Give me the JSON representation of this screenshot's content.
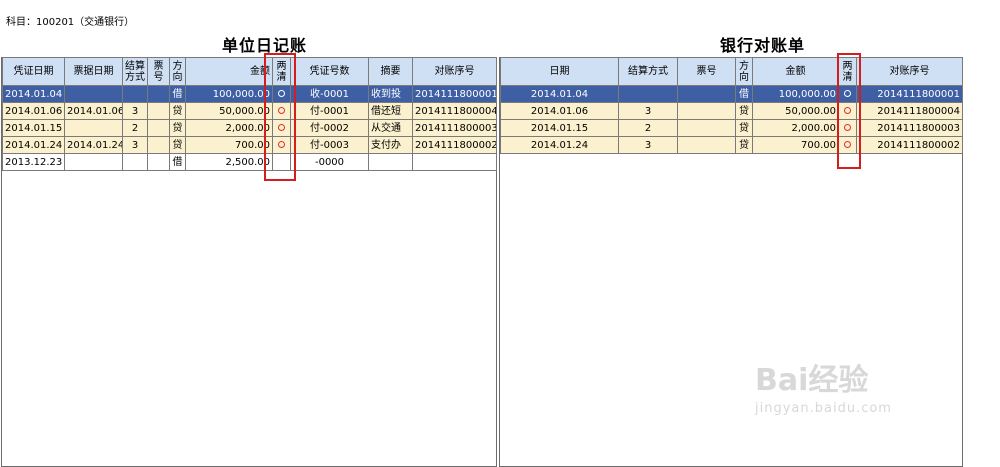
{
  "subject": "科目：100201（交通银行）",
  "journal": {
    "title": "单位日记账",
    "columns": [
      "凭证日期",
      "票据日期",
      "结算方式",
      "票号",
      "方向",
      "金额",
      "两清",
      "凭证号数",
      "摘要",
      "对账序号"
    ],
    "rows": [
      {
        "voucher_date": "2014.01.04",
        "bill_date": "",
        "method": "",
        "ticket": "",
        "direction": "借",
        "amount": "100,000.00",
        "cleared": true,
        "voucher_no": "收-0001",
        "summary": "收到投",
        "seq": "2014111800001",
        "state": "selected"
      },
      {
        "voucher_date": "2014.01.06",
        "bill_date": "2014.01.06",
        "method": "3",
        "ticket": "",
        "direction": "贷",
        "amount": "50,000.00",
        "cleared": true,
        "voucher_no": "付-0001",
        "summary": "借还短",
        "seq": "2014111800004",
        "state": "data"
      },
      {
        "voucher_date": "2014.01.15",
        "bill_date": "",
        "method": "2",
        "ticket": "",
        "direction": "贷",
        "amount": "2,000.00",
        "cleared": true,
        "voucher_no": "付-0002",
        "summary": "从交通",
        "seq": "2014111800003",
        "state": "data"
      },
      {
        "voucher_date": "2014.01.24",
        "bill_date": "2014.01.24",
        "method": "3",
        "ticket": "",
        "direction": "贷",
        "amount": "700.00",
        "cleared": true,
        "voucher_no": "付-0003",
        "summary": "支付办",
        "seq": "2014111800002",
        "state": "data"
      },
      {
        "voucher_date": "2013.12.23",
        "bill_date": "",
        "method": "",
        "ticket": "",
        "direction": "借",
        "amount": "2,500.00",
        "cleared": false,
        "voucher_no": "-0000",
        "summary": "",
        "seq": "",
        "state": "plain"
      }
    ]
  },
  "statement": {
    "title": "银行对账单",
    "columns": [
      "日期",
      "结算方式",
      "票号",
      "方向",
      "金额",
      "两清",
      "对账序号"
    ],
    "rows": [
      {
        "date": "2014.01.04",
        "method": "",
        "ticket": "",
        "direction": "借",
        "amount": "100,000.00",
        "cleared": true,
        "seq": "2014111800001",
        "state": "selected"
      },
      {
        "date": "2014.01.06",
        "method": "3",
        "ticket": "",
        "direction": "贷",
        "amount": "50,000.00",
        "cleared": true,
        "seq": "2014111800004",
        "state": "data"
      },
      {
        "date": "2014.01.15",
        "method": "2",
        "ticket": "",
        "direction": "贷",
        "amount": "2,000.00",
        "cleared": true,
        "seq": "2014111800003",
        "state": "data"
      },
      {
        "date": "2014.01.24",
        "method": "3",
        "ticket": "",
        "direction": "贷",
        "amount": "700.00",
        "cleared": true,
        "seq": "2014111800002",
        "state": "data"
      }
    ]
  },
  "colors": {
    "header": "#cfe0f4",
    "selected": "#3e5fa3",
    "row": "#fbf1cf",
    "mark": "#e0302a",
    "highlight": "#d41e1e"
  },
  "icons": {
    "cleared": "circle-mark-icon"
  },
  "watermark": {
    "logo": "Bai经验",
    "url": "jingyan.baidu.com"
  }
}
